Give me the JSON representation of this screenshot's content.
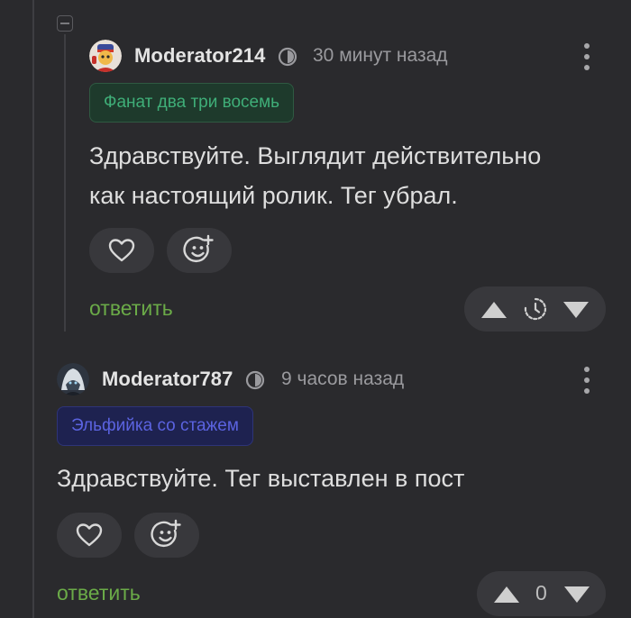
{
  "comments": [
    {
      "username": "Moderator214",
      "time": "30 минут назад",
      "badge": "Фанат два три восемь",
      "text_line1": "Здравствуйте. Выглядит действительно",
      "text_line2": "как настоящий ролик. Тег убрал.",
      "reply_label": "ответить",
      "rating": ""
    },
    {
      "username": "Moderator787",
      "time": "9 часов назад",
      "badge": "Эльфийка со стажем",
      "text_line1": "Здравствуйте. Тег выставлен в пост",
      "reply_label": "ответить",
      "rating": "0"
    }
  ],
  "colors": {
    "background": "#2a2a2d",
    "reply_green": "#6bab48",
    "badge_green": "#3fae78",
    "badge_blue": "#5b63e0"
  },
  "icons": [
    "collapse-icon",
    "avatar",
    "moderator-icon",
    "more-options-icon",
    "heart-icon",
    "add-emoji-icon",
    "upvote-icon",
    "timer-icon",
    "downvote-icon"
  ]
}
